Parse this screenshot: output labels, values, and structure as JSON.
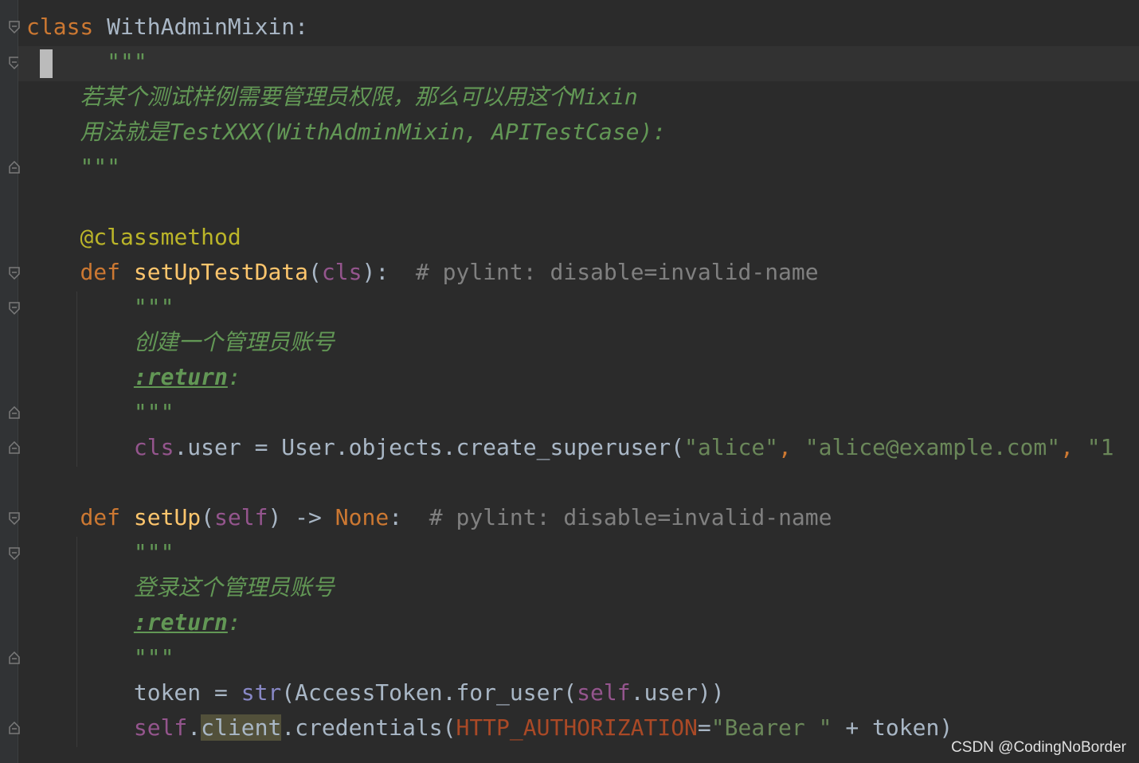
{
  "editor": {
    "lines": {
      "l1": {
        "kw": "class",
        "name": " WithAdminMixin:"
      },
      "l2": {
        "doc": "\"\"\""
      },
      "l3": {
        "doc": "若某个测试样例需要管理员权限，那么可以用这个Mixin"
      },
      "l4": {
        "doc": "用法就是TestXXX(WithAdminMixin, APITestCase):"
      },
      "l5": {
        "doc": "\"\"\""
      },
      "l7": {
        "deco": "@classmethod"
      },
      "l8": {
        "kw": "def",
        "fn": "setUpTestData",
        "paren_open": "(",
        "param": "cls",
        "paren_close": "):",
        "comment": "# pylint: disable=invalid-name"
      },
      "l9": {
        "doc": "\"\"\""
      },
      "l10": {
        "doc": "创建一个管理员账号"
      },
      "l11": {
        "tag": ":return",
        "colon": ":"
      },
      "l12": {
        "doc": "\"\"\""
      },
      "l13": {
        "cls": "cls",
        "rest": ".user = User.objects.create_superuser(",
        "s1": "\"alice\"",
        "sep1": ", ",
        "s2": "\"alice@example.com\"",
        "sep2": ", ",
        "s3": "\"1"
      },
      "l15": {
        "kw": "def",
        "fn": "setUp",
        "paren_open": "(",
        "param": "self",
        "paren_close": ") -> ",
        "ret": "None",
        "colon": ":",
        "comment": "# pylint: disable=invalid-name"
      },
      "l16": {
        "doc": "\"\"\""
      },
      "l17": {
        "doc": "登录这个管理员账号"
      },
      "l18": {
        "tag": ":return",
        "colon": ":"
      },
      "l19": {
        "doc": "\"\"\""
      },
      "l20": {
        "var": "token = ",
        "builtin": "str",
        "mid": "(AccessToken.for_user(",
        "self": "self",
        "end": ".user))"
      },
      "l21": {
        "self": "self",
        "dot": ".",
        "client": "client",
        "call": ".credentials(",
        "kwarg": "HTTP_AUTHORIZATION",
        "eq": "=",
        "str": "\"Bearer \"",
        "plus": " + token)"
      }
    }
  },
  "watermark": "CSDN @CodingNoBorder",
  "colors": {
    "background": "#2b2b2b",
    "keyword": "#cc7832",
    "function": "#ffc66d",
    "docstring": "#629755",
    "string": "#6a8759",
    "comment": "#808080",
    "self": "#94558d",
    "decorator": "#bbb529"
  }
}
